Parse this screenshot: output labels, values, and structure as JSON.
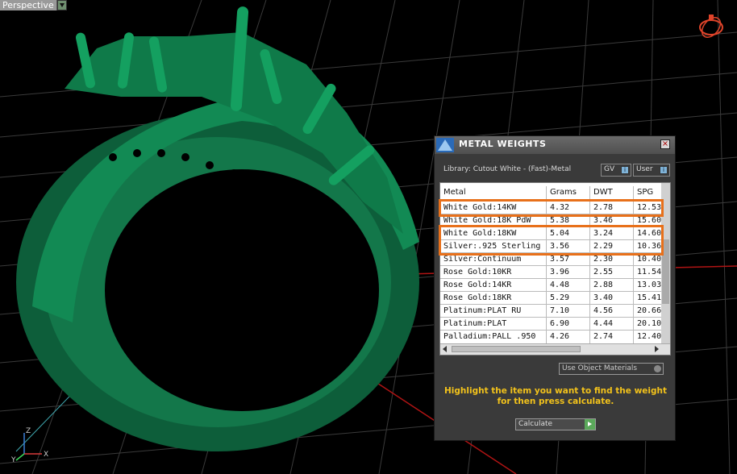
{
  "viewport": {
    "label": "Perspective"
  },
  "panel": {
    "title": "METAL WEIGHTS",
    "close_glyph": "×",
    "library": "Library: Cutout White - (Fast)-Metal",
    "gv_label": "GV",
    "user_label": "User",
    "columns": [
      "Metal",
      "Grams",
      "DWT",
      "SPG"
    ],
    "rows": [
      [
        "White Gold:14KW",
        "4.32",
        "2.78",
        "12.53"
      ],
      [
        "White Gold:18K PdW",
        "5.38",
        "3.46",
        "15.60"
      ],
      [
        "White Gold:18KW",
        "5.04",
        "3.24",
        "14.60"
      ],
      [
        "Silver:.925 Sterling",
        "3.56",
        "2.29",
        "10.36"
      ],
      [
        "Silver:Continuum",
        "3.57",
        "2.30",
        "10.40"
      ],
      [
        "Rose Gold:10KR",
        "3.96",
        "2.55",
        "11.54"
      ],
      [
        "Rose Gold:14KR",
        "4.48",
        "2.88",
        "13.03"
      ],
      [
        "Rose Gold:18KR",
        "5.29",
        "3.40",
        "15.41"
      ],
      [
        "Platinum:PLAT RU",
        "7.10",
        "4.56",
        "20.66"
      ],
      [
        "Platinum:PLAT",
        "6.90",
        "4.44",
        "20.10"
      ],
      [
        "Palladium:PALL .950",
        "4.26",
        "2.74",
        "12.40"
      ]
    ],
    "use_object_materials": "Use Object Materials",
    "instruction": "Highlight the item you want to find the weight for then press calculate.",
    "calculate_label": "Calculate"
  },
  "axes": {
    "z": "Z",
    "x": "X",
    "y": "Y"
  },
  "colors": {
    "highlight": "#e8701a",
    "instruction": "#f2c21b",
    "ring": "#0f6e45"
  }
}
